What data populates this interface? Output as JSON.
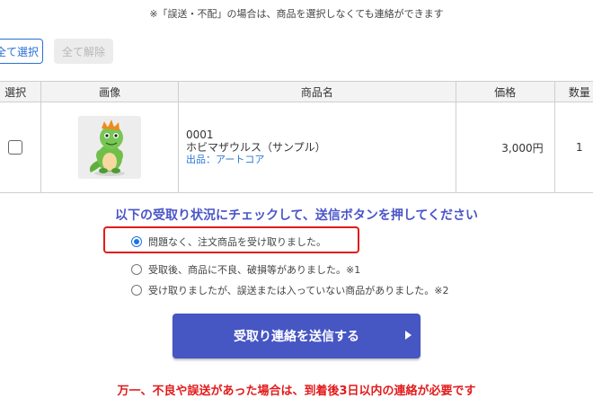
{
  "notice": "※「誤送・不配」の場合は、商品を選択しなくても連絡ができます",
  "buttons": {
    "select_all": "全て選択",
    "deselect_all": "全て解除"
  },
  "table": {
    "headers": [
      "選択",
      "画像",
      "商品名",
      "価格",
      "数量"
    ],
    "rows": [
      {
        "selected": false,
        "image_icon": "dinosaur-figure-icon",
        "code": "0001",
        "name": "ホビマザウルス（サンプル）",
        "seller": "出品：アートコア",
        "price": "3,000円",
        "quantity": "1"
      }
    ]
  },
  "instruction": "以下の受取り状況にチェックして、送信ボタンを押してください",
  "options": [
    {
      "label": "問題なく、注文商品を受け取りました。",
      "selected": true
    },
    {
      "label": "受取後、商品に不良、破損等がありました。※1",
      "selected": false
    },
    {
      "label": "受け取りましたが、誤送または入っていない商品がありました。※2",
      "selected": false
    }
  ],
  "submit": {
    "label": "受取り連絡を送信する",
    "color": "#4656c3"
  },
  "warning": "万一、不良や誤送があった場合は、到着後3日以内の連絡が必要です",
  "colors": {
    "accent_blue": "#2a6fd6",
    "highlight_red": "#e21b1b",
    "instruction_blue": "#4a55c8"
  }
}
